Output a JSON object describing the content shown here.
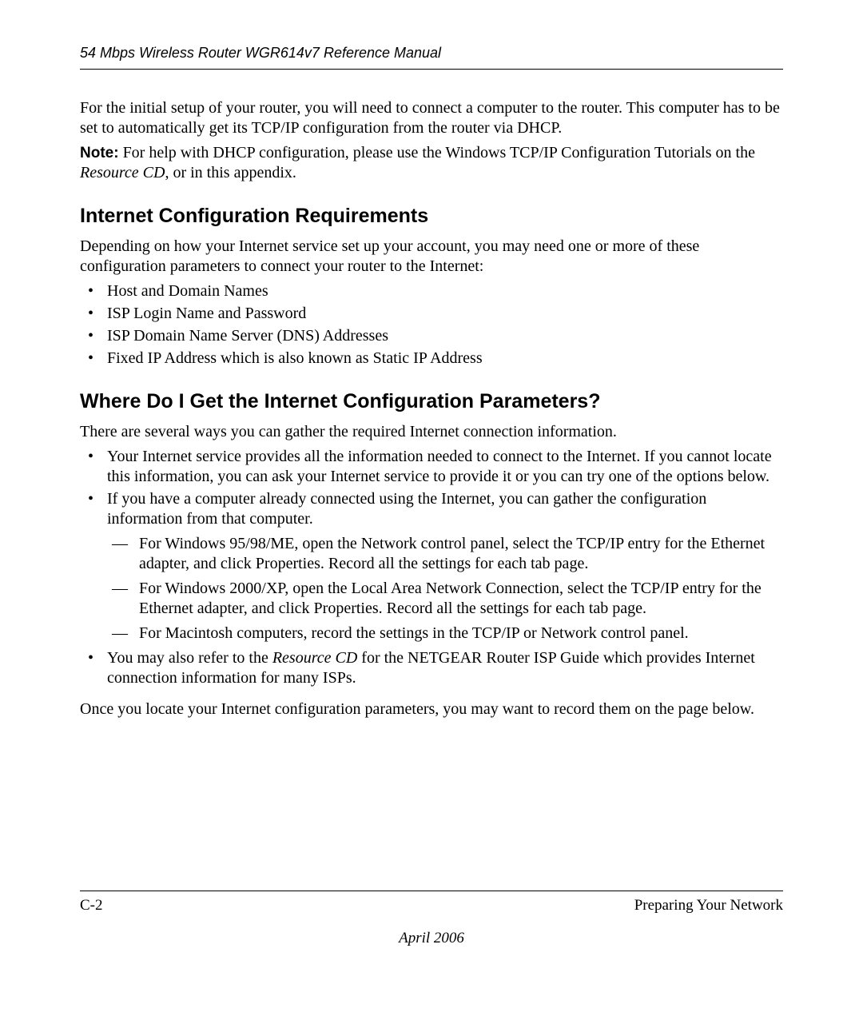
{
  "header": {
    "running_title": "54 Mbps Wireless Router WGR614v7 Reference Manual"
  },
  "intro": {
    "p1": "For the initial setup of your router, you will need to connect a computer to the router. This computer has to be set to automatically get its TCP/IP configuration from the router via DHCP.",
    "note_label": "Note:",
    "note_before": " For help with DHCP configuration, please use the Windows TCP/IP Configuration Tutorials on the ",
    "note_em": "Resource CD",
    "note_after": ", or in this appendix."
  },
  "section1": {
    "title": "Internet Configuration Requirements",
    "p1": "Depending on how your Internet service set up your account, you may need one or more of these configuration parameters to connect your router to the Internet:",
    "items": [
      "Host and Domain Names",
      "ISP Login Name and Password",
      "ISP Domain Name Server (DNS) Addresses",
      "Fixed IP Address which is also known as Static IP Address"
    ]
  },
  "section2": {
    "title": "Where Do I Get the Internet Configuration Parameters?",
    "p1": "There are several ways you can gather the required Internet connection information.",
    "b1": "Your Internet service provides all the information needed to connect to the Internet. If you cannot locate this information, you can ask your Internet service to provide it or you can try one of the options below.",
    "b2": "If you have a computer already connected using the Internet, you can gather the configuration information from that computer.",
    "b2_subs": [
      "For Windows 95/98/ME, open the Network control panel, select the TCP/IP entry for the Ethernet adapter, and click Properties. Record all the settings for each tab page.",
      "For Windows 2000/XP, open the Local Area Network Connection, select the TCP/IP entry for the Ethernet adapter, and click Properties. Record all the settings for each tab page.",
      "For Macintosh computers, record the settings in the TCP/IP or Network control panel."
    ],
    "b3_before": "You may also refer to the ",
    "b3_em": "Resource CD",
    "b3_after": " for the NETGEAR Router ISP Guide which provides Internet connection information for many ISPs.",
    "closing": "Once you locate your Internet configuration parameters, you may want to record them on the page below."
  },
  "footer": {
    "page_num": "C-2",
    "section_name": "Preparing Your Network",
    "date": "April 2006"
  }
}
